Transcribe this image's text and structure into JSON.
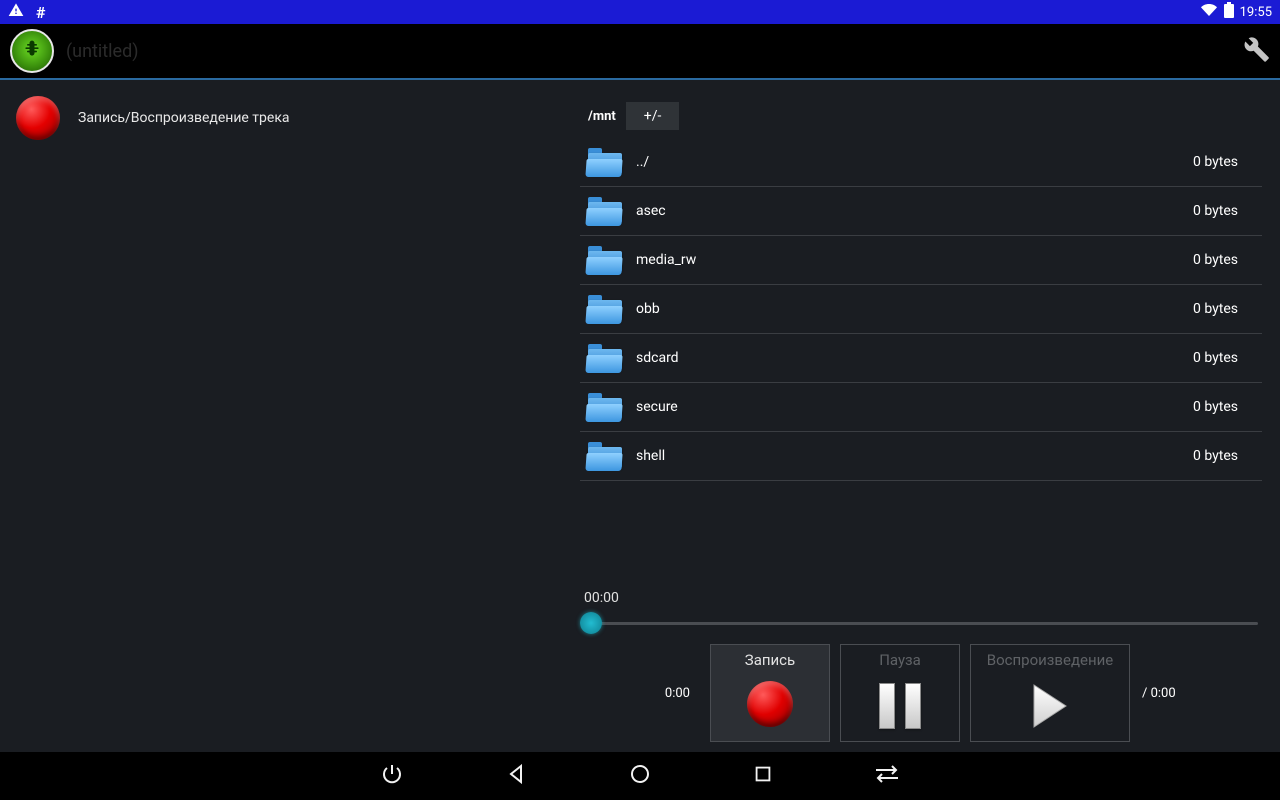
{
  "status": {
    "time": "19:55"
  },
  "appbar": {
    "title": "(untitled)"
  },
  "left": {
    "label": "Запись/Воспроизведение трека"
  },
  "path": {
    "current": "/mnt",
    "toggle": "+/-"
  },
  "folders": [
    {
      "name": "../",
      "size": "0 bytes"
    },
    {
      "name": "asec",
      "size": "0 bytes"
    },
    {
      "name": "media_rw",
      "size": "0 bytes"
    },
    {
      "name": "obb",
      "size": "0 bytes"
    },
    {
      "name": "sdcard",
      "size": "0 bytes"
    },
    {
      "name": "secure",
      "size": "0 bytes"
    },
    {
      "name": "shell",
      "size": "0 bytes"
    }
  ],
  "player": {
    "seek_time": "00:00",
    "elapsed": "0:00",
    "total": "/ 0:00",
    "record": "Запись",
    "pause": "Пауза",
    "play": "Воспроизведение"
  }
}
